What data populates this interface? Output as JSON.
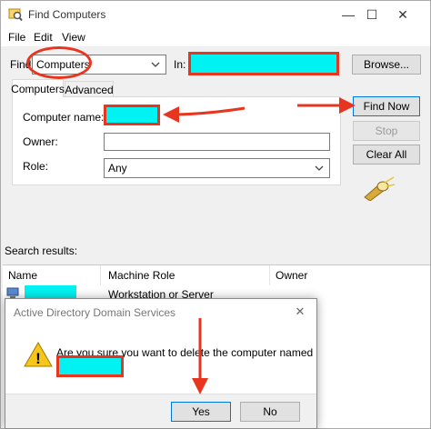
{
  "window": {
    "title": "Find Computers",
    "minimize_glyph": "—",
    "maximize_glyph": "☐",
    "close_glyph": "✕"
  },
  "menu": [
    "File",
    "Edit",
    "View"
  ],
  "find": {
    "find_label": "Find:",
    "find_value": "Computers",
    "in_label": "In:",
    "browse_label": "Browse..."
  },
  "tabs": [
    "Computers",
    "Advanced"
  ],
  "form": {
    "computer_name_label": "Computer name:",
    "owner_label": "Owner:",
    "role_label": "Role:",
    "role_value": "Any"
  },
  "buttons": {
    "find_now": "Find Now",
    "stop": "Stop",
    "clear_all": "Clear All"
  },
  "results": {
    "label": "Search results:",
    "columns": [
      "Name",
      "Machine Role",
      "Owner"
    ],
    "rows": [
      {
        "name": "",
        "role": "Workstation or Server",
        "owner": ""
      }
    ]
  },
  "dialog": {
    "title": "Active Directory Domain Services",
    "message": "Are you sure you want to delete the computer named",
    "yes": "Yes",
    "no": "No",
    "close_glyph": "✕",
    "warning_glyph": "!"
  },
  "colors": {
    "annotation_red": "#e8351f",
    "redaction_cyan": "#00f2f2",
    "accent_blue": "#0078d7"
  },
  "icons": [
    "search-window-icon",
    "warning-icon",
    "computer-icon",
    "search-flashlight-icon"
  ]
}
